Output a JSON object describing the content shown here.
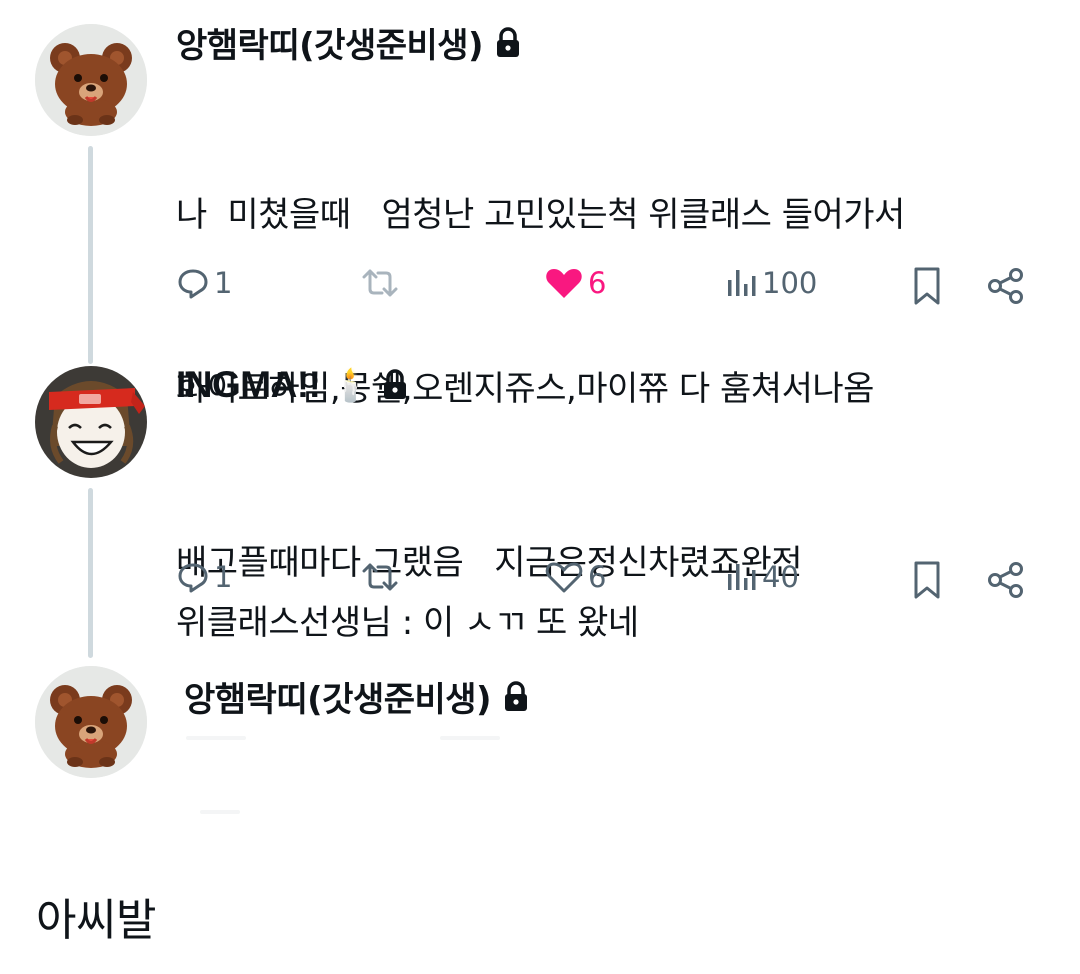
{
  "posts": [
    {
      "author": "앙햄락띠(갓생준비생)",
      "author_suffix": "",
      "locked": true,
      "lines": [
        "나  미쳤을때   엄청난 고민있는척 위클래스 들어가서",
        "화이트하임,몽쉘,오렌지쥬스,마이쮸 다 훔쳐서나옴",
        "배고플때마다 그랬음   지금은정신차렸죠완전"
      ],
      "actions": {
        "replies": "1",
        "reposts": "",
        "likes": "6",
        "liked": true,
        "views": "100"
      }
    },
    {
      "author": "INGMA!!",
      "author_suffix": "🕯️",
      "locked": true,
      "lines": [
        "위클래스선생님 : 이 ㅅㄲ 또 왔네"
      ],
      "actions": {
        "replies": "1",
        "reposts": "",
        "likes": "6",
        "liked": false,
        "views": "40"
      }
    },
    {
      "author": "앙햄락띠(갓생준비생)",
      "author_suffix": "",
      "locked": true,
      "lines": [],
      "actions": null
    }
  ],
  "caption": "아씨발",
  "colors": {
    "like": "#f91880",
    "icon": "#536471",
    "text": "#0f1419",
    "thread_line": "#cfd9de"
  },
  "icons": [
    "reply-icon",
    "repost-icon",
    "like-icon",
    "views-icon",
    "bookmark-icon",
    "share-icon",
    "lock-icon",
    "bear-avatar",
    "headband-avatar"
  ]
}
